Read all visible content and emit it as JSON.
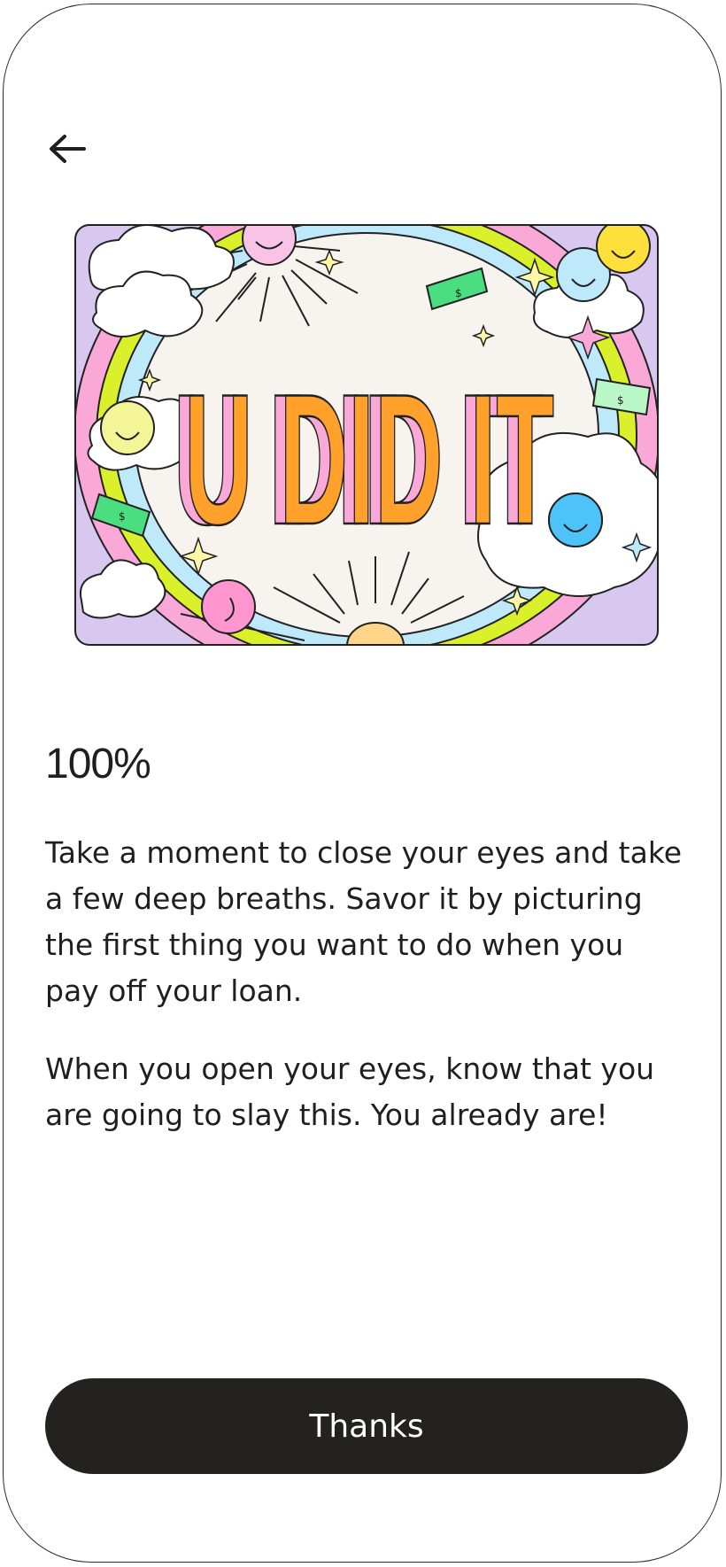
{
  "header": {
    "back_icon": "arrow-left-icon"
  },
  "illustration": {
    "banner_text": "U DID IT",
    "colors": {
      "accent_orange": "#FFA12B",
      "pink": "#F9A8D8",
      "cream": "#F7F3EE",
      "sky": "#BDE9FB",
      "lime": "#D9F02A",
      "green": "#4ADE80"
    }
  },
  "main": {
    "progress_label": "100%",
    "paragraph_1": "Take a moment to close your eyes and take a few deep breaths. Savor it by picturing the first thing you want to do when you pay off your loan.",
    "paragraph_2": "When you open your eyes, know that you are going to slay this. You already are!"
  },
  "footer": {
    "button_label": "Thanks"
  }
}
